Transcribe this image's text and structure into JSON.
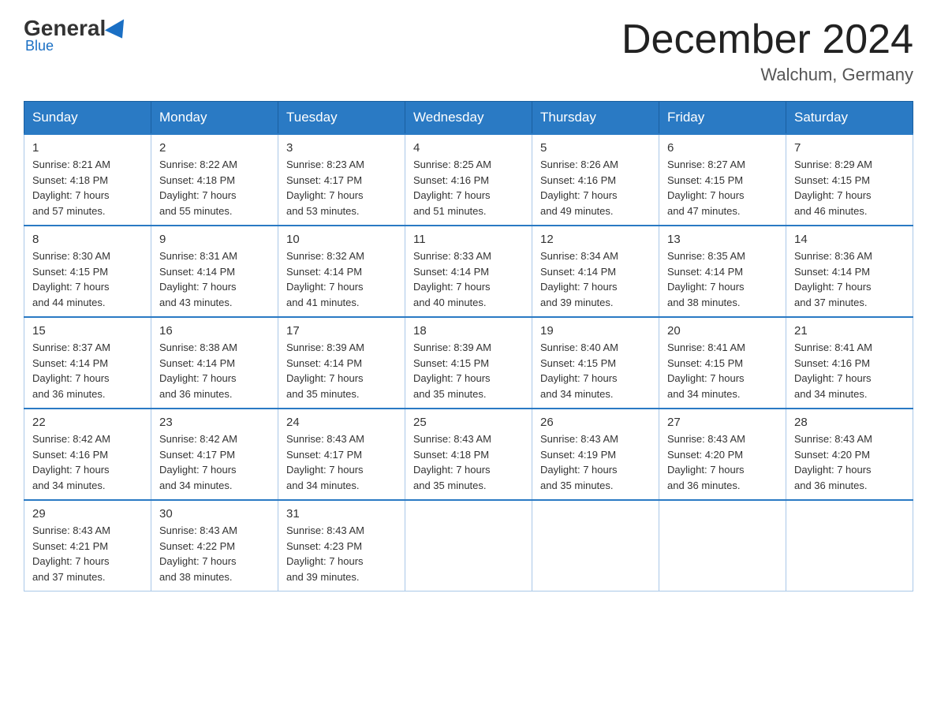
{
  "logo": {
    "general": "General",
    "blue": "Blue"
  },
  "title": "December 2024",
  "location": "Walchum, Germany",
  "days_of_week": [
    "Sunday",
    "Monday",
    "Tuesday",
    "Wednesday",
    "Thursday",
    "Friday",
    "Saturday"
  ],
  "weeks": [
    [
      {
        "day": "1",
        "sunrise": "8:21 AM",
        "sunset": "4:18 PM",
        "daylight": "7 hours and 57 minutes."
      },
      {
        "day": "2",
        "sunrise": "8:22 AM",
        "sunset": "4:18 PM",
        "daylight": "7 hours and 55 minutes."
      },
      {
        "day": "3",
        "sunrise": "8:23 AM",
        "sunset": "4:17 PM",
        "daylight": "7 hours and 53 minutes."
      },
      {
        "day": "4",
        "sunrise": "8:25 AM",
        "sunset": "4:16 PM",
        "daylight": "7 hours and 51 minutes."
      },
      {
        "day": "5",
        "sunrise": "8:26 AM",
        "sunset": "4:16 PM",
        "daylight": "7 hours and 49 minutes."
      },
      {
        "day": "6",
        "sunrise": "8:27 AM",
        "sunset": "4:15 PM",
        "daylight": "7 hours and 47 minutes."
      },
      {
        "day": "7",
        "sunrise": "8:29 AM",
        "sunset": "4:15 PM",
        "daylight": "7 hours and 46 minutes."
      }
    ],
    [
      {
        "day": "8",
        "sunrise": "8:30 AM",
        "sunset": "4:15 PM",
        "daylight": "7 hours and 44 minutes."
      },
      {
        "day": "9",
        "sunrise": "8:31 AM",
        "sunset": "4:14 PM",
        "daylight": "7 hours and 43 minutes."
      },
      {
        "day": "10",
        "sunrise": "8:32 AM",
        "sunset": "4:14 PM",
        "daylight": "7 hours and 41 minutes."
      },
      {
        "day": "11",
        "sunrise": "8:33 AM",
        "sunset": "4:14 PM",
        "daylight": "7 hours and 40 minutes."
      },
      {
        "day": "12",
        "sunrise": "8:34 AM",
        "sunset": "4:14 PM",
        "daylight": "7 hours and 39 minutes."
      },
      {
        "day": "13",
        "sunrise": "8:35 AM",
        "sunset": "4:14 PM",
        "daylight": "7 hours and 38 minutes."
      },
      {
        "day": "14",
        "sunrise": "8:36 AM",
        "sunset": "4:14 PM",
        "daylight": "7 hours and 37 minutes."
      }
    ],
    [
      {
        "day": "15",
        "sunrise": "8:37 AM",
        "sunset": "4:14 PM",
        "daylight": "7 hours and 36 minutes."
      },
      {
        "day": "16",
        "sunrise": "8:38 AM",
        "sunset": "4:14 PM",
        "daylight": "7 hours and 36 minutes."
      },
      {
        "day": "17",
        "sunrise": "8:39 AM",
        "sunset": "4:14 PM",
        "daylight": "7 hours and 35 minutes."
      },
      {
        "day": "18",
        "sunrise": "8:39 AM",
        "sunset": "4:15 PM",
        "daylight": "7 hours and 35 minutes."
      },
      {
        "day": "19",
        "sunrise": "8:40 AM",
        "sunset": "4:15 PM",
        "daylight": "7 hours and 34 minutes."
      },
      {
        "day": "20",
        "sunrise": "8:41 AM",
        "sunset": "4:15 PM",
        "daylight": "7 hours and 34 minutes."
      },
      {
        "day": "21",
        "sunrise": "8:41 AM",
        "sunset": "4:16 PM",
        "daylight": "7 hours and 34 minutes."
      }
    ],
    [
      {
        "day": "22",
        "sunrise": "8:42 AM",
        "sunset": "4:16 PM",
        "daylight": "7 hours and 34 minutes."
      },
      {
        "day": "23",
        "sunrise": "8:42 AM",
        "sunset": "4:17 PM",
        "daylight": "7 hours and 34 minutes."
      },
      {
        "day": "24",
        "sunrise": "8:43 AM",
        "sunset": "4:17 PM",
        "daylight": "7 hours and 34 minutes."
      },
      {
        "day": "25",
        "sunrise": "8:43 AM",
        "sunset": "4:18 PM",
        "daylight": "7 hours and 35 minutes."
      },
      {
        "day": "26",
        "sunrise": "8:43 AM",
        "sunset": "4:19 PM",
        "daylight": "7 hours and 35 minutes."
      },
      {
        "day": "27",
        "sunrise": "8:43 AM",
        "sunset": "4:20 PM",
        "daylight": "7 hours and 36 minutes."
      },
      {
        "day": "28",
        "sunrise": "8:43 AM",
        "sunset": "4:20 PM",
        "daylight": "7 hours and 36 minutes."
      }
    ],
    [
      {
        "day": "29",
        "sunrise": "8:43 AM",
        "sunset": "4:21 PM",
        "daylight": "7 hours and 37 minutes."
      },
      {
        "day": "30",
        "sunrise": "8:43 AM",
        "sunset": "4:22 PM",
        "daylight": "7 hours and 38 minutes."
      },
      {
        "day": "31",
        "sunrise": "8:43 AM",
        "sunset": "4:23 PM",
        "daylight": "7 hours and 39 minutes."
      },
      null,
      null,
      null,
      null
    ]
  ],
  "labels": {
    "sunrise": "Sunrise:",
    "sunset": "Sunset:",
    "daylight": "Daylight:"
  }
}
